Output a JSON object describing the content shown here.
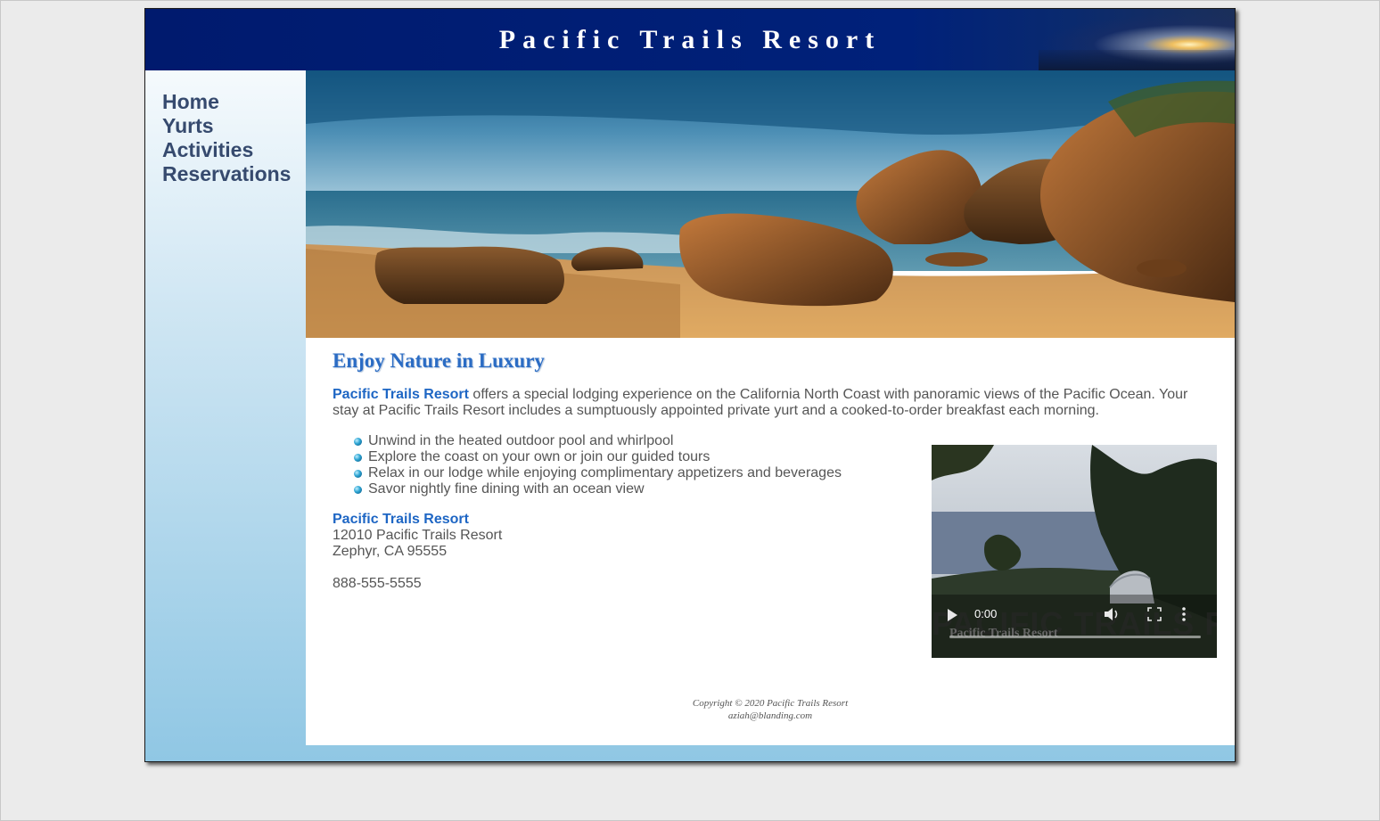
{
  "header": {
    "title": "Pacific Trails Resort"
  },
  "nav": {
    "items": [
      {
        "label": "Home"
      },
      {
        "label": "Yurts"
      },
      {
        "label": "Activities"
      },
      {
        "label": "Reservations"
      }
    ]
  },
  "main": {
    "heading": "Enjoy Nature in Luxury",
    "intro_brand": "Pacific Trails Resort",
    "intro_text": " offers a special lodging experience on the California North Coast with panoramic views of the Pacific Ocean. Your stay at Pacific Trails Resort includes a sumptuously appointed private yurt and a cooked-to-order breakfast each morning.",
    "features": [
      "Unwind in the heated outdoor pool and whirlpool",
      "Explore the coast on your own or join our guided tours",
      "Relax in our lodge while enjoying complimentary appetizers and beverages",
      "Savor nightly fine dining with an ocean view"
    ],
    "contact": {
      "name": "Pacific Trails Resort",
      "street": "12010 Pacific Trails Resort",
      "city": "Zephyr, CA 95555",
      "phone": "888-555-5555"
    },
    "video": {
      "time": "0:00",
      "watermark": "PACIFIC TRAILS RESORT",
      "watermark_sub": "Pacific Trails Resort"
    }
  },
  "footer": {
    "copyright": "Copyright © 2020 Pacific Trails Resort",
    "email": "aziah@blanding.com"
  },
  "colors": {
    "header_bg": "#001a6e",
    "nav_text": "#364a6e",
    "heading": "#2b6cc4",
    "brand_text": "#1e66c4",
    "body_text": "#555555",
    "page_bg": "#ebebeb"
  }
}
